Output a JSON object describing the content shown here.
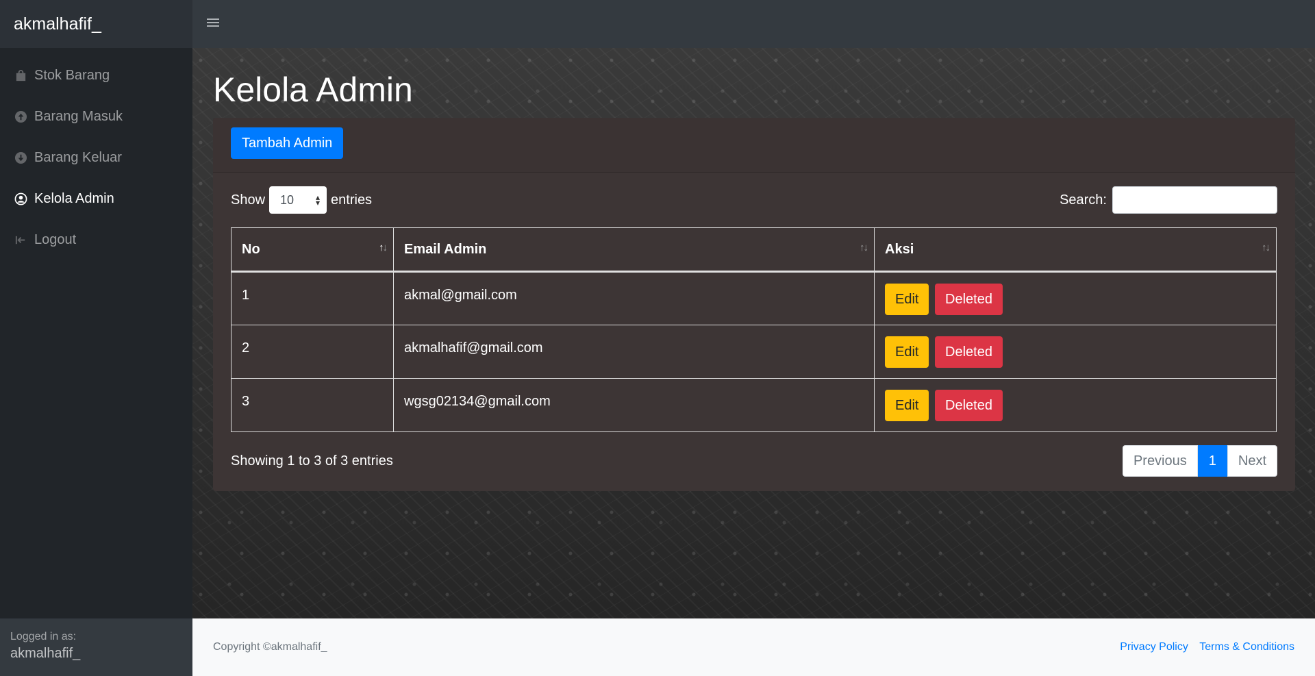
{
  "brand": "akmalhafif_",
  "sidebar": {
    "items": [
      {
        "label": "Stok Barang",
        "icon": "bag-icon"
      },
      {
        "label": "Barang Masuk",
        "icon": "arrow-up-circle-icon"
      },
      {
        "label": "Barang Keluar",
        "icon": "arrow-down-circle-icon"
      },
      {
        "label": "Kelola Admin",
        "icon": "user-circle-icon",
        "active": true
      },
      {
        "label": "Logout",
        "icon": "logout-icon"
      }
    ],
    "footer": {
      "label": "Logged in as:",
      "user": "akmalhafif_"
    }
  },
  "page": {
    "title": "Kelola Admin",
    "add_button": "Tambah Admin"
  },
  "datatable": {
    "show_label": "Show",
    "entries_value": "10",
    "entries_label": "entries",
    "search_label": "Search:",
    "search_value": "",
    "columns": [
      "No",
      "Email Admin",
      "Aksi"
    ],
    "rows": [
      {
        "no": "1",
        "email": "akmal@gmail.com"
      },
      {
        "no": "2",
        "email": "akmalhafif@gmail.com"
      },
      {
        "no": "3",
        "email": "wgsg02134@gmail.com"
      }
    ],
    "edit_label": "Edit",
    "delete_label": "Deleted",
    "info": "Showing 1 to 3 of 3 entries",
    "pager": {
      "previous": "Previous",
      "current": "1",
      "next": "Next"
    }
  },
  "footer": {
    "copyright": "Copyright ©akmalhafif_",
    "links": [
      "Privacy Policy",
      "Terms & Conditions"
    ]
  },
  "colors": {
    "primary": "#007bff",
    "warning": "#ffc107",
    "danger": "#dc3545",
    "sidebar": "#212529",
    "navbar": "#343a40"
  }
}
